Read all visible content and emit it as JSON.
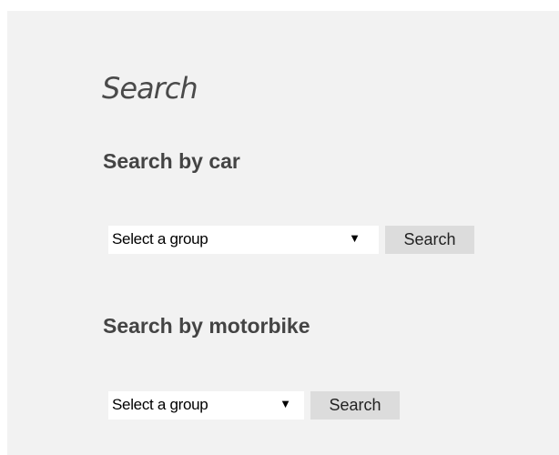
{
  "page": {
    "title": "Search"
  },
  "car_search": {
    "heading": "Search by car",
    "select_value": "Select a group",
    "arrow_icon": "dropdown-arrow-icon",
    "button_label": "Search"
  },
  "motorbike_search": {
    "heading": "Search by motorbike",
    "select_value": "Select a group",
    "arrow_icon": "dropdown-arrow-icon",
    "button_label": "Search"
  },
  "colors": {
    "panel_background": "#f2f2f2",
    "button_background": "#dcdcdc",
    "heading_text": "#444444"
  }
}
